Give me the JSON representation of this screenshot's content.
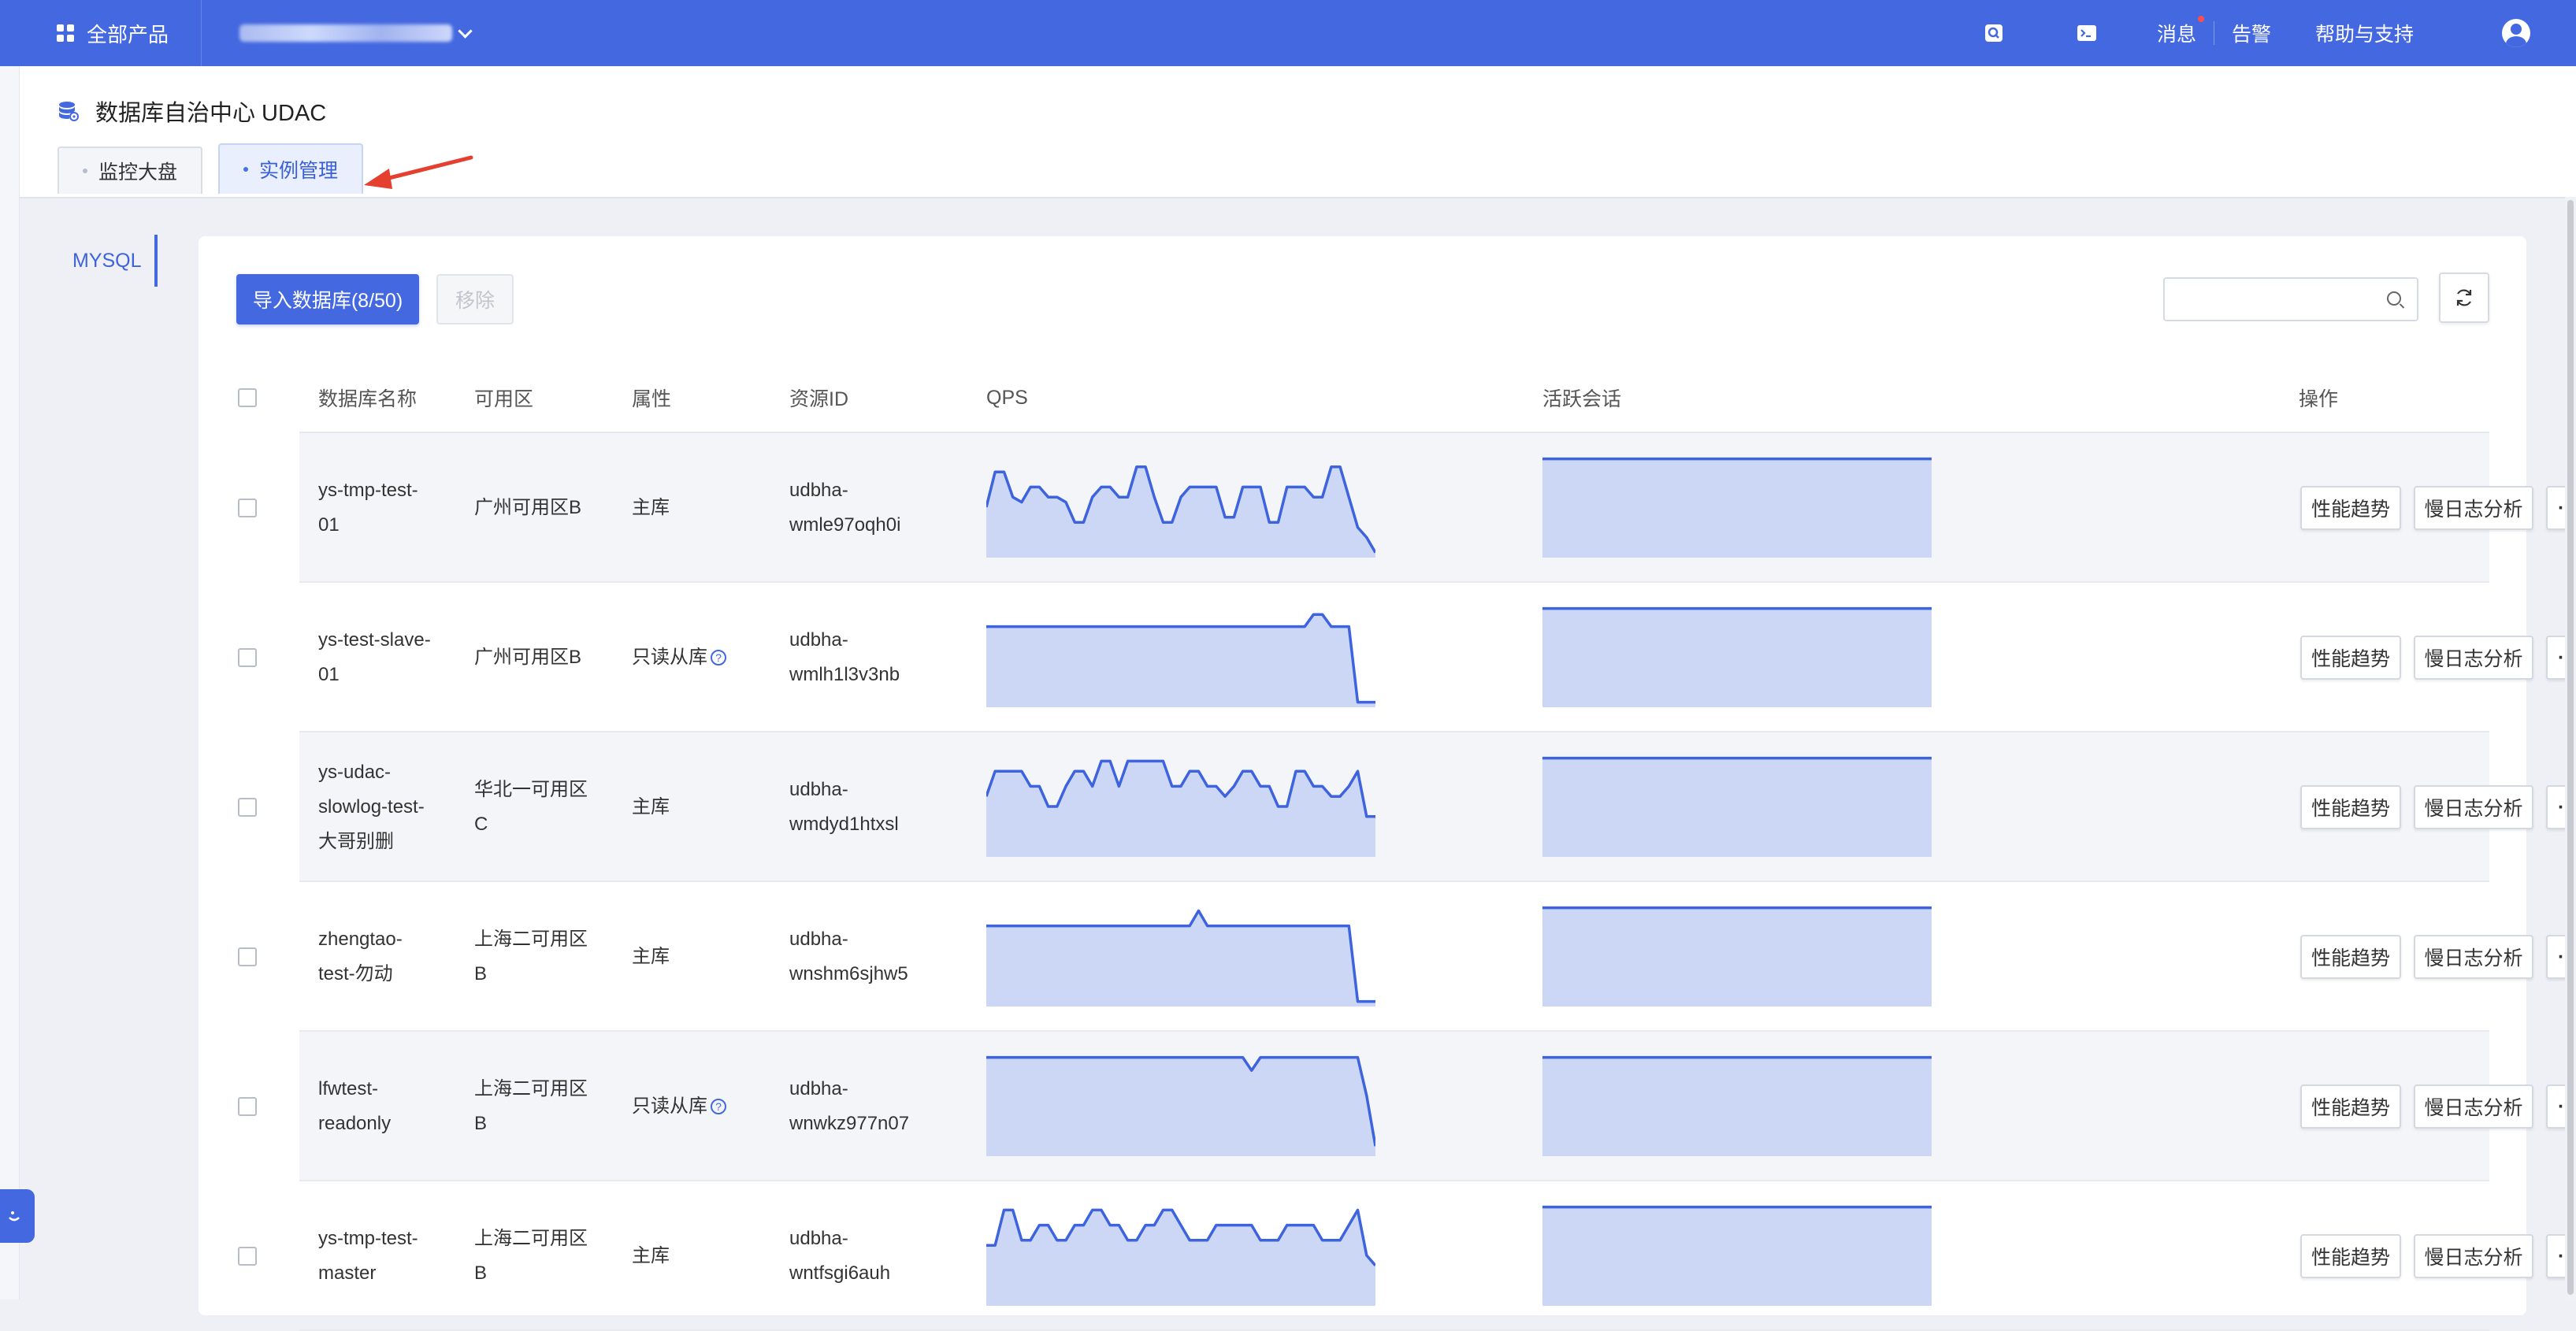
{
  "topbar": {
    "products_label": "全部产品",
    "messages_label": "消息",
    "alerts_label": "告警",
    "help_label": "帮助与支持"
  },
  "app": {
    "title": "数据库自治中心 UDAC"
  },
  "tabs": [
    {
      "label": "监控大盘",
      "active": false
    },
    {
      "label": "实例管理",
      "active": true
    }
  ],
  "sidebar": {
    "items": [
      {
        "label": "MYSQL",
        "active": true
      }
    ]
  },
  "toolbar": {
    "import_label": "导入数据库(8/50)",
    "remove_label": "移除",
    "search_placeholder": ""
  },
  "table": {
    "headers": {
      "name": "数据库名称",
      "zone": "可用区",
      "attr": "属性",
      "resource_id": "资源ID",
      "qps": "QPS",
      "sessions": "活跃会话",
      "ops": "操作"
    },
    "ops_labels": {
      "perf": "性能趋势",
      "slowlog": "慢日志分析",
      "more": "···"
    },
    "rows": [
      {
        "name": [
          "ys-tmp-test-",
          "01"
        ],
        "zone": [
          "广州可用区B"
        ],
        "attr": "主库",
        "readonly": false,
        "resource_id": [
          "udbha-",
          "wmle97oqh0i"
        ],
        "qps": [
          0.5,
          0.85,
          0.85,
          0.6,
          0.55,
          0.7,
          0.7,
          0.6,
          0.6,
          0.55,
          0.35,
          0.35,
          0.6,
          0.7,
          0.7,
          0.6,
          0.6,
          0.9,
          0.9,
          0.6,
          0.35,
          0.35,
          0.6,
          0.7,
          0.7,
          0.7,
          0.7,
          0.4,
          0.4,
          0.7,
          0.7,
          0.7,
          0.35,
          0.35,
          0.7,
          0.7,
          0.7,
          0.6,
          0.6,
          0.9,
          0.9,
          0.6,
          0.3,
          0.2,
          0.05
        ],
        "qps_drop": true,
        "sessions": [
          0.98
        ]
      },
      {
        "name": [
          "ys-test-slave-",
          "01"
        ],
        "zone": [
          "广州可用区B"
        ],
        "attr": "只读从库",
        "readonly": true,
        "resource_id": [
          "udbha-",
          "wmlh1l3v3nb"
        ],
        "qps": [
          0.8,
          0.8,
          0.8,
          0.8,
          0.8,
          0.8,
          0.8,
          0.8,
          0.8,
          0.8,
          0.8,
          0.8,
          0.8,
          0.8,
          0.8,
          0.8,
          0.8,
          0.8,
          0.8,
          0.8,
          0.8,
          0.8,
          0.8,
          0.8,
          0.8,
          0.8,
          0.8,
          0.8,
          0.8,
          0.8,
          0.8,
          0.8,
          0.8,
          0.8,
          0.8,
          0.8,
          0.8,
          0.92,
          0.92,
          0.8,
          0.8,
          0.8,
          0.05,
          0.05,
          0.05
        ],
        "qps_drop": true,
        "sessions": [
          0.98
        ]
      },
      {
        "name": [
          "ys-udac-",
          "slowlog-test-",
          "大哥别删"
        ],
        "zone": [
          "华北一可用区",
          "C"
        ],
        "attr": "主库",
        "readonly": false,
        "resource_id": [
          "udbha-",
          "wmdyd1htxsl"
        ],
        "qps": [
          0.6,
          0.85,
          0.85,
          0.85,
          0.85,
          0.7,
          0.7,
          0.5,
          0.5,
          0.7,
          0.85,
          0.85,
          0.7,
          0.95,
          0.95,
          0.7,
          0.95,
          0.95,
          0.95,
          0.95,
          0.95,
          0.7,
          0.7,
          0.85,
          0.85,
          0.7,
          0.7,
          0.6,
          0.7,
          0.85,
          0.85,
          0.7,
          0.7,
          0.5,
          0.5,
          0.85,
          0.85,
          0.7,
          0.7,
          0.6,
          0.6,
          0.7,
          0.85,
          0.4,
          0.4
        ],
        "qps_drop": true,
        "sessions": [
          0.98
        ]
      },
      {
        "name": [
          "zhengtao-",
          "test-勿动"
        ],
        "zone": [
          "上海二可用区",
          "B"
        ],
        "attr": "主库",
        "readonly": false,
        "resource_id": [
          "udbha-",
          "wnshm6sjhw5"
        ],
        "qps": [
          0.8,
          0.8,
          0.8,
          0.8,
          0.8,
          0.8,
          0.8,
          0.8,
          0.8,
          0.8,
          0.8,
          0.8,
          0.8,
          0.8,
          0.8,
          0.8,
          0.8,
          0.8,
          0.8,
          0.8,
          0.8,
          0.8,
          0.8,
          0.8,
          0.95,
          0.8,
          0.8,
          0.8,
          0.8,
          0.8,
          0.8,
          0.8,
          0.8,
          0.8,
          0.8,
          0.8,
          0.8,
          0.8,
          0.8,
          0.8,
          0.8,
          0.8,
          0.05,
          0.05,
          0.05
        ],
        "qps_drop": true,
        "sessions": [
          0.98
        ]
      },
      {
        "name": [
          "lfwtest-",
          "readonly"
        ],
        "zone": [
          "上海二可用区",
          "B"
        ],
        "attr": "只读从库",
        "readonly": true,
        "resource_id": [
          "udbha-",
          "wnwkz977n07"
        ],
        "qps": [
          0.98,
          0.98,
          0.98,
          0.98,
          0.98,
          0.98,
          0.98,
          0.98,
          0.98,
          0.98,
          0.98,
          0.98,
          0.98,
          0.98,
          0.98,
          0.98,
          0.98,
          0.98,
          0.98,
          0.98,
          0.98,
          0.98,
          0.98,
          0.98,
          0.98,
          0.98,
          0.98,
          0.98,
          0.98,
          0.98,
          0.85,
          0.98,
          0.98,
          0.98,
          0.98,
          0.98,
          0.98,
          0.98,
          0.98,
          0.98,
          0.98,
          0.98,
          0.98,
          0.6,
          0.1
        ],
        "qps_drop": true,
        "sessions": [
          0.98
        ]
      },
      {
        "name": [
          "ys-tmp-test-",
          "master"
        ],
        "zone": [
          "上海二可用区",
          "B"
        ],
        "attr": "主库",
        "readonly": false,
        "resource_id": [
          "udbha-",
          "wntfsgi6auh"
        ],
        "qps": [
          0.6,
          0.6,
          0.95,
          0.95,
          0.65,
          0.65,
          0.8,
          0.8,
          0.65,
          0.65,
          0.8,
          0.8,
          0.95,
          0.95,
          0.8,
          0.8,
          0.65,
          0.65,
          0.8,
          0.8,
          0.95,
          0.95,
          0.8,
          0.65,
          0.65,
          0.65,
          0.8,
          0.8,
          0.8,
          0.8,
          0.8,
          0.65,
          0.65,
          0.65,
          0.8,
          0.8,
          0.8,
          0.8,
          0.65,
          0.65,
          0.65,
          0.8,
          0.95,
          0.5,
          0.4
        ],
        "qps_drop": true,
        "sessions": [
          0.98
        ]
      }
    ]
  }
}
